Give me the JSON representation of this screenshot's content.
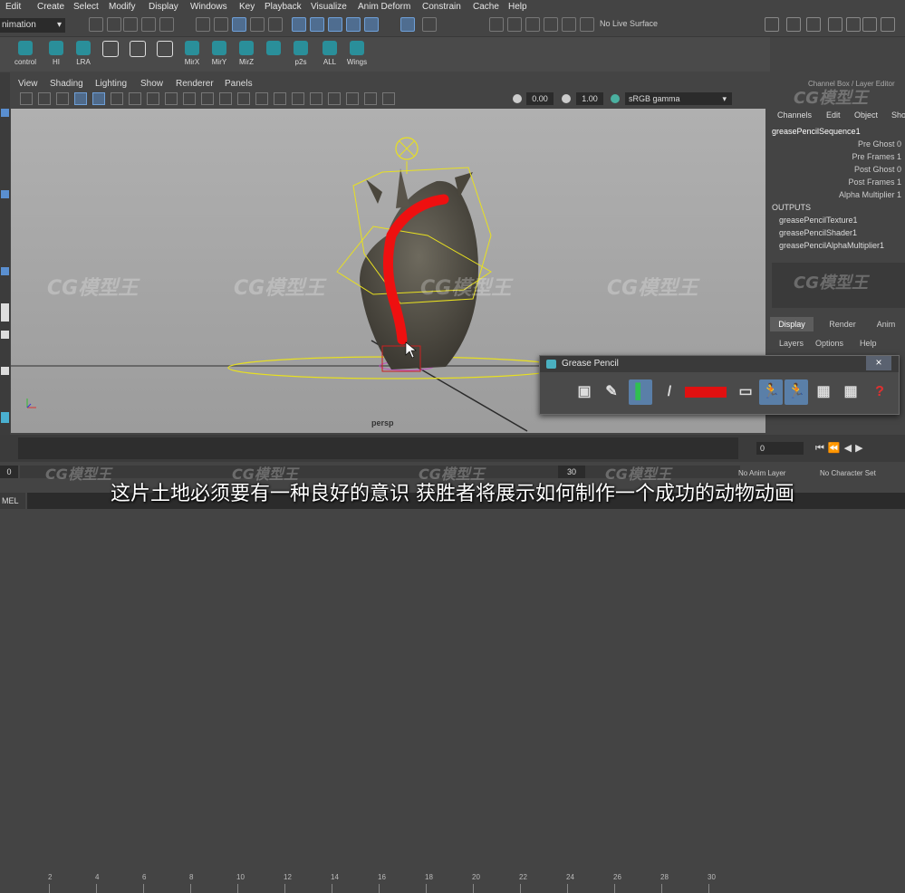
{
  "menu": [
    "Edit",
    "Create",
    "Select",
    "Modify",
    "Display",
    "Windows",
    "Key",
    "Playback",
    "Visualize",
    "Anim Deform",
    "Constrain",
    "Cache",
    "Help"
  ],
  "mode_selector": "nimation",
  "live_surface": "No Live Surface",
  "shelf": [
    {
      "label": "control"
    },
    {
      "label": "HI"
    },
    {
      "label": "LRA"
    },
    {
      "label": ""
    },
    {
      "label": ""
    },
    {
      "label": ""
    },
    {
      "label": "MirX"
    },
    {
      "label": "MirY"
    },
    {
      "label": "MirZ"
    },
    {
      "label": ""
    },
    {
      "label": "p2s"
    },
    {
      "label": "ALL"
    },
    {
      "label": "Wings"
    }
  ],
  "panel_menu": [
    "View",
    "Shading",
    "Lighting",
    "Show",
    "Renderer",
    "Panels"
  ],
  "exposure": "0.00",
  "gamma": "1.00",
  "color_space": "sRGB gamma",
  "camera_label": "persp",
  "channel_box": {
    "header": "Channel Box / Layer Editor",
    "menu": [
      "Channels",
      "Edit",
      "Object",
      "Sho"
    ],
    "node": "greasePencilSequence1",
    "attrs": [
      {
        "name": "Pre Ghost",
        "value": "0"
      },
      {
        "name": "Pre Frames",
        "value": "1"
      },
      {
        "name": "Post Ghost",
        "value": "0"
      },
      {
        "name": "Post Frames",
        "value": "1"
      },
      {
        "name": "Alpha Multiplier",
        "value": "1"
      }
    ],
    "outputs_label": "OUTPUTS",
    "outputs": [
      "greasePencilTexture1",
      "greasePencilShader1",
      "greasePencilAlphaMultiplier1"
    ],
    "tabs": [
      "Display",
      "Render",
      "Anim"
    ],
    "layer_menu": [
      "Layers",
      "Options",
      "Help"
    ]
  },
  "grease_pencil": {
    "title": "Grease Pencil",
    "close": "×",
    "tools": [
      "camera-icon",
      "pencil-icon",
      "marker-icon",
      "brush-icon",
      "color-swatch",
      "eraser-icon",
      "ghost-prev-icon",
      "ghost-next-icon",
      "add-frame-icon",
      "remove-frame-icon",
      "help-icon"
    ],
    "stroke_color": "#e01010"
  },
  "timeline": {
    "ticks": [
      "2",
      "4",
      "6",
      "8",
      "10",
      "12",
      "14",
      "16",
      "18",
      "20",
      "22",
      "24",
      "26",
      "28",
      "30"
    ],
    "current_frame": "0"
  },
  "range": {
    "start": "0",
    "end": "30"
  },
  "anim_layer": "No Anim Layer",
  "char_set": "No Character Set",
  "cmd_label": "MEL",
  "subtitle": "这片土地必须要有一种良好的意识 获胜者将展示如何制作一个成功的动物动画",
  "watermark": "CG模型王",
  "colors": {
    "accent_blue": "#5a8fd0",
    "stroke_red": "#e01010",
    "rig_yellow": "#e8e020",
    "selection": "#6fa0d8"
  }
}
